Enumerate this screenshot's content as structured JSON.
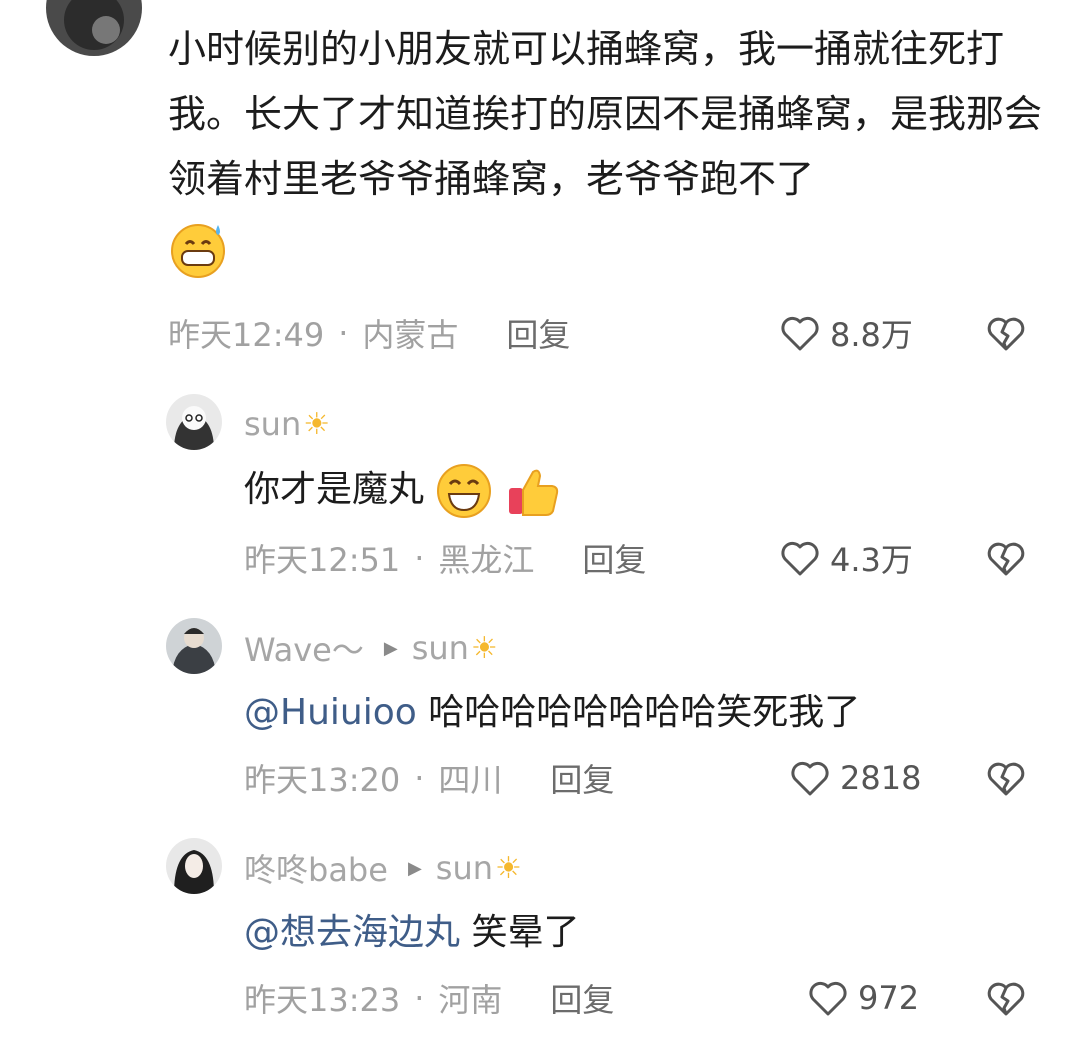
{
  "comments": [
    {
      "text": "小时候别的小朋友就可以捅蜂窝，我一捅就往死打我。长大了才知道挨打的原因不是捅蜂窝，是我那会领着村里老爷爷捅蜂窝，老爷爷跑不了",
      "time": "昨天12:49",
      "location": "内蒙古",
      "reply_label": "回复",
      "likes": "8.8万"
    }
  ],
  "replies": [
    {
      "username": "sun",
      "text": "你才是魔丸",
      "time": "昨天12:51",
      "location": "黑龙江",
      "reply_label": "回复",
      "likes": "4.3万"
    },
    {
      "username": "Wave～",
      "reply_to": "sun",
      "mention": "@Huiuioo",
      "text": "哈哈哈哈哈哈哈哈笑死我了",
      "time": "昨天13:20",
      "location": "四川",
      "reply_label": "回复",
      "likes": "2818"
    },
    {
      "username": "咚咚babe",
      "reply_to": "sun",
      "mention": "@想去海边丸",
      "text": "笑晕了",
      "time": "昨天13:23",
      "location": "河南",
      "reply_label": "回复",
      "likes": "972"
    }
  ],
  "colors": {
    "mention": "#3f5d88",
    "meta": "#a1a1a1",
    "name": "#a6a6a6"
  }
}
